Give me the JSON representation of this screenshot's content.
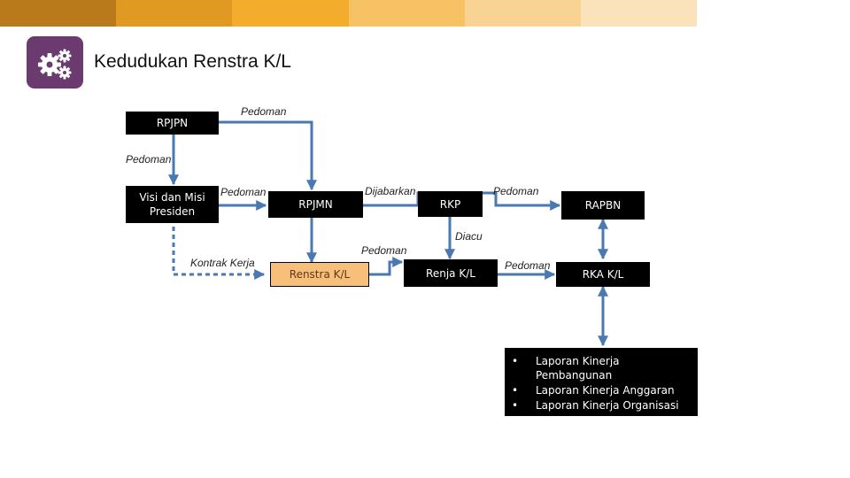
{
  "header": {
    "title": "Kedudukan Renstra K/L",
    "bar_colors": [
      "#b87a1a",
      "#e09a22",
      "#f3ac2c",
      "#f6c263",
      "#f8d394",
      "#fae3bb"
    ]
  },
  "logo": {
    "icon": "gears-icon",
    "color": "#6b3a6e"
  },
  "boxes": {
    "rpjpn": "RPJPN",
    "visi_line1": "Visi dan Misi",
    "visi_line2": "Presiden",
    "rpjmn": "RPJMN",
    "rkp": "RKP",
    "rapbn": "RAPBN",
    "renstra": "Renstra K/L",
    "renja": "Renja K/L",
    "rka": "RKA K/L"
  },
  "labels": {
    "pedoman_top": "Pedoman",
    "pedoman_left": "Pedoman",
    "pedoman_visi": "Pedoman",
    "dijabarkan": "Dijabarkan",
    "pedoman_rkp": "Pedoman",
    "diacu": "Diacu",
    "pedoman_renstra": "Pedoman",
    "kontrak_kerja": "Kontrak Kerja",
    "pedoman_renja": "Pedoman"
  },
  "reports": [
    {
      "bullet": "•",
      "text": "Laporan Kinerja Pembangunan"
    },
    {
      "bullet": "•",
      "text": "Laporan Kinerja Anggaran"
    },
    {
      "bullet": "•",
      "text": "Laporan Kinerja Organisasi"
    }
  ],
  "colors": {
    "arrow": "#4a78b0",
    "renstra_fill": "#f8bf7b"
  }
}
